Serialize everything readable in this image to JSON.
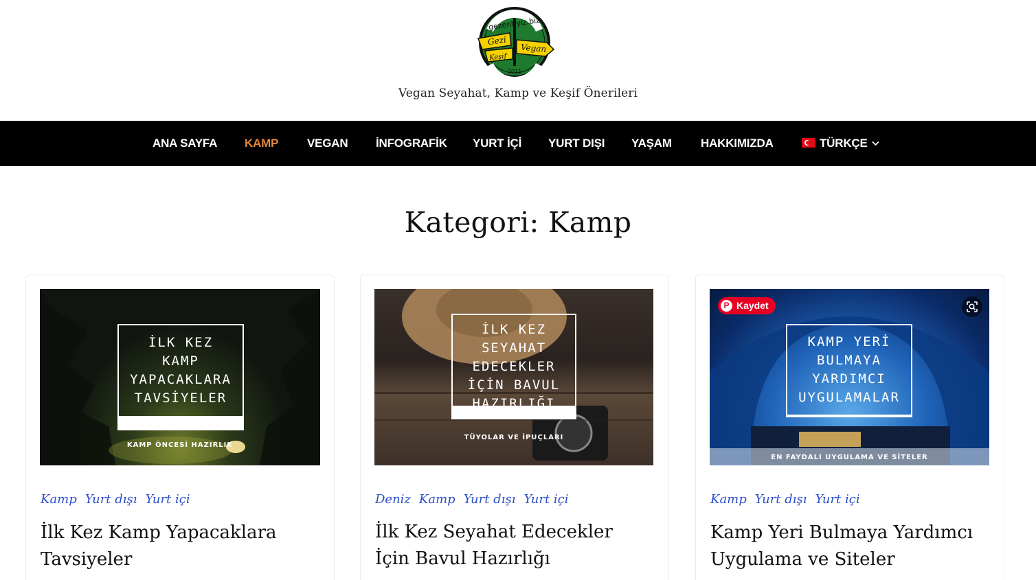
{
  "header": {
    "logo": {
      "top_text": "gezentiyiz.biz",
      "sign_left_top": "Gezi",
      "sign_left_bottom": "Keşif",
      "sign_right": "Vegan",
      "year": "2011"
    },
    "tagline": "Vegan Seyahat, Kamp ve Keşif Önerileri"
  },
  "nav": {
    "items": [
      {
        "label": "ANA SAYFA",
        "active": false
      },
      {
        "label": "KAMP",
        "active": true
      },
      {
        "label": "VEGAN",
        "active": false
      },
      {
        "label": "İNFOGRAFİK",
        "active": false
      },
      {
        "label": "YURT İÇİ",
        "active": false
      },
      {
        "label": "YURT DIŞI",
        "active": false
      },
      {
        "label": "YAŞAM",
        "active": false
      },
      {
        "label": "HAKKIMIZDA",
        "active": false
      }
    ],
    "language": "TÜRKÇE",
    "active_color": "#e5883a"
  },
  "page": {
    "title": "Kategori: Kamp"
  },
  "posts": [
    {
      "image_title": "İLK KEZ\nKAMP\nYAPACAKLARA\nTAVSİYELER",
      "image_caption": "KAMP ÖNCESİ HAZIRLIK",
      "categories": [
        "Kamp",
        "Yurt dışı",
        "Yurt içi"
      ],
      "title": "İlk Kez Kamp Yapacaklara Tavsiyeler"
    },
    {
      "image_title": "İLK KEZ\nSEYAHAT\nEDECEKLER\nİÇİN BAVUL\nHAZIRLIĞI",
      "image_caption": "TÜYOLAR VE İPUÇLARI",
      "categories": [
        "Deniz",
        "Kamp",
        "Yurt dışı",
        "Yurt içi"
      ],
      "title": "İlk Kez Seyahat Edecekler İçin Bavul Hazırlığı"
    },
    {
      "image_title": "KAMP YERİ\nBULMAYA\nYARDIMCI\nUYGULAMALAR",
      "image_caption": "EN FAYDALI UYGULAMA VE SİTELER",
      "categories": [
        "Kamp",
        "Yurt dışı",
        "Yurt içi"
      ],
      "title": "Kamp Yeri Bulmaya Yardımcı Uygulama ve Siteler",
      "pin_label": "Kaydet"
    }
  ],
  "colors": {
    "nav_bg": "#000000",
    "category_link": "#2d50c8",
    "pinterest": "#e60023"
  },
  "icons": [
    "pinterest-icon",
    "visual-search-icon",
    "chevron-down-icon",
    "turkey-flag-icon"
  ]
}
